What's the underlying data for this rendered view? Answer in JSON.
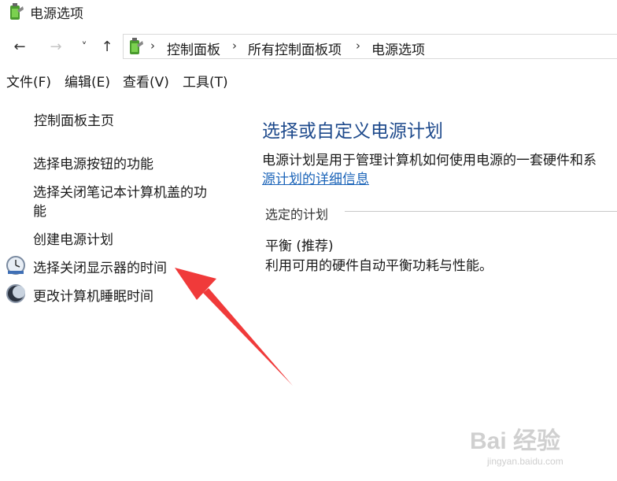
{
  "window": {
    "title": "电源选项",
    "icon": "power-options-icon"
  },
  "nav": {
    "back": "←",
    "forward": "→",
    "recent": "˅",
    "up": "↑",
    "breadcrumb": [
      "控制面板",
      "所有控制面板项",
      "电源选项"
    ],
    "separator": "›"
  },
  "menu": [
    "文件(F)",
    "编辑(E)",
    "查看(V)",
    "工具(T)"
  ],
  "sidebar": {
    "home": "控制面板主页",
    "items": [
      {
        "label": "选择电源按钮的功能"
      },
      {
        "label_line1": "选择关闭笔记本计算机盖的功",
        "label_line2": "能"
      },
      {
        "label": "创建电源计划"
      },
      {
        "label": "选择关闭显示器的时间",
        "icon": "clock-icon"
      },
      {
        "label": "更改计算机睡眠时间",
        "icon": "moon-icon"
      }
    ]
  },
  "main": {
    "title": "选择或自定义电源计划",
    "description": "电源计划是用于管理计算机如何使用电源的一套硬件和系",
    "link": "源计划的详细信息",
    "selected_label": "选定的计划",
    "plan_name": "平衡 (推荐)",
    "plan_desc": "利用可用的硬件自动平衡功耗与性能。"
  },
  "watermark": {
    "brand": "Bai 经验",
    "url": "jingyan.baidu.com"
  },
  "colors": {
    "title_blue": "#1e4a8c",
    "link_blue": "#1a63b8",
    "arrow_red": "#f03a3a"
  }
}
